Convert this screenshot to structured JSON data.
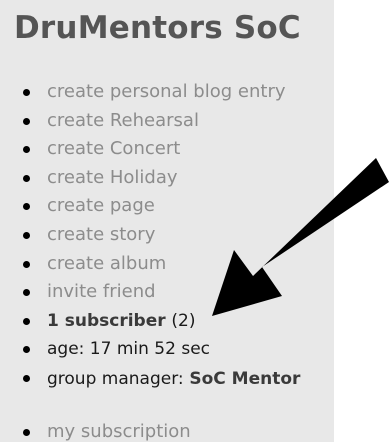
{
  "block": {
    "title": "DruMentors SoC",
    "links": [
      "create personal blog entry",
      "create Rehearsal",
      "create Concert",
      "create Holiday",
      "create page",
      "create story",
      "create album",
      "invite friend"
    ],
    "subscriber_label": "1 subscriber",
    "subscriber_count": "(2)",
    "age": "age: 17 min 52 sec",
    "manager_prefix": "group manager:",
    "manager_name": "SoC Mentor",
    "my_subscription": "my subscription"
  },
  "colors": {
    "panel_background": "#e8e8e8",
    "link": "#8c8c8c",
    "title": "#555555",
    "arrow": "#000000"
  },
  "annotation": {
    "icon": "arrow-pointer-icon"
  }
}
